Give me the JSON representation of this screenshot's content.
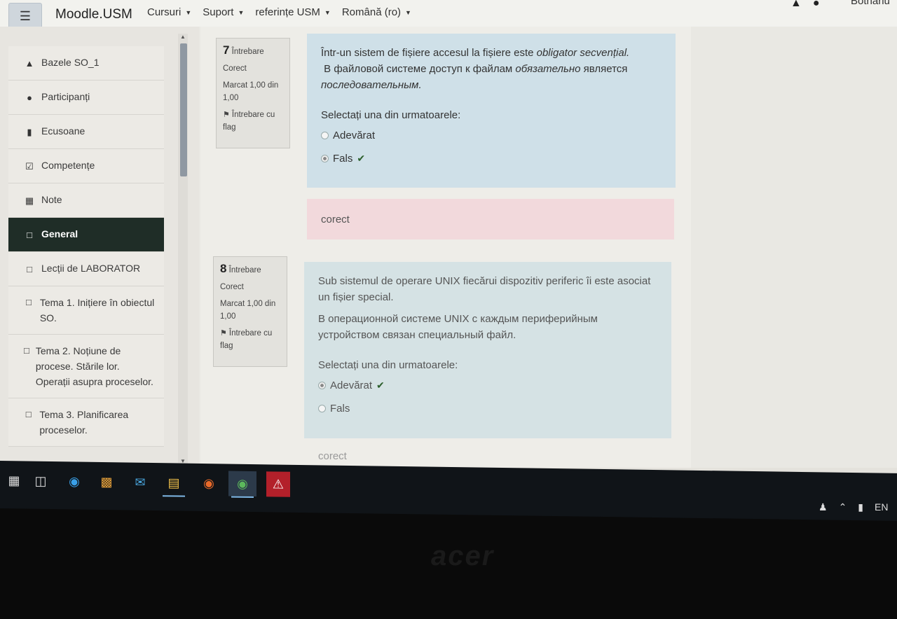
{
  "navbar": {
    "menu_icon": "hamburger-icon",
    "brand": "Moodle.USM",
    "menus": [
      "Cursuri",
      "Suport",
      "referințe USM",
      "Română (ro)"
    ],
    "icons": [
      "bell-icon",
      "chat-icon"
    ],
    "username": "Bothariu"
  },
  "sidebar": {
    "items": [
      {
        "icon": "graduation-cap-icon",
        "label": "Bazele SO_1"
      },
      {
        "icon": "users-icon",
        "label": "Participanți"
      },
      {
        "icon": "shield-icon",
        "label": "Ecusoane"
      },
      {
        "icon": "checkbox-icon",
        "label": "Competențe"
      },
      {
        "icon": "table-icon",
        "label": "Note"
      },
      {
        "icon": "folder-icon",
        "label": "General",
        "active": true
      },
      {
        "icon": "folder-icon",
        "label": "Lecții de LABORATOR"
      },
      {
        "icon": "folder-icon",
        "label": "Tema 1. Inițiere în obiectul SO."
      },
      {
        "icon": "folder-icon",
        "label": "Tema 2. Noțiune de procese. Stările lor. Operații asupra proceselor."
      },
      {
        "icon": "folder-icon",
        "label": "Tema 3. Planificarea proceselor."
      }
    ]
  },
  "questions": [
    {
      "number": "7",
      "word": "Întrebare",
      "status": "Corect",
      "mark": "Marcat 1,00 din 1,00",
      "flag": "Întrebare cu flag",
      "text_ro_plain": "Într-un sistem de fișiere accesul la fișiere este ",
      "text_ro_em": "obligator secvențial.",
      "text_ru_plain": "В файловой системе доступ к файлам ",
      "text_ru_em1": "обязательно",
      "text_ru_plain2": " является ",
      "text_ru_em2": "последовательным.",
      "prompt": "Selectați una din urmatoarele:",
      "options": [
        {
          "label": "Adevărat",
          "selected": false,
          "correct": false
        },
        {
          "label": "Fals",
          "selected": true,
          "correct": true
        }
      ],
      "feedback": "corect"
    },
    {
      "number": "8",
      "word": "Întrebare",
      "status": "Corect",
      "mark": "Marcat 1,00 din 1,00",
      "flag": "Întrebare cu flag",
      "text_ro": "Sub sistemul de operare UNIX fiecărui dispozitiv periferic îi este asociat un fișier special.",
      "text_ru": "В операционной системе UNIX с каждым периферийным устройством связан специальный файл.",
      "prompt": "Selectați una din urmatoarele:",
      "options": [
        {
          "label": "Adevărat",
          "selected": true,
          "correct": true
        },
        {
          "label": "Fals",
          "selected": false,
          "correct": false
        }
      ],
      "feedback": "corect"
    }
  ],
  "taskbar": {
    "apps": [
      "windows-start-icon",
      "task-view-icon",
      "edge-icon",
      "store-icon",
      "mail-icon",
      "file-explorer-icon",
      "ubuntu-icon",
      "chrome-icon",
      "pdf-reader-icon"
    ],
    "tray_lang": "EN"
  },
  "bezel_logo": "acer"
}
